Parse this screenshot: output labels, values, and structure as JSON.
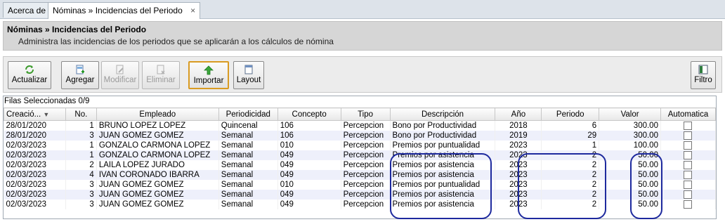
{
  "tabs": [
    {
      "label": "Acerca de"
    },
    {
      "label": "Nóminas » Incidencias del Periodo",
      "close": "×"
    }
  ],
  "header": {
    "title": "Nóminas » Incidencias del Periodo",
    "subtitle": "Administra las incidencias de los periodos que se aplicarán a los cálculos de nómina"
  },
  "toolbar": {
    "actualizar": {
      "label": "Actualizar",
      "icon": "refresh-icon"
    },
    "agregar": {
      "label": "Agregar",
      "icon": "add-doc-icon"
    },
    "modificar": {
      "label": "Modificar",
      "icon": "edit-doc-icon"
    },
    "eliminar": {
      "label": "Eliminar",
      "icon": "delete-doc-icon"
    },
    "importar": {
      "label": "Importar",
      "icon": "import-arrow-icon"
    },
    "layout": {
      "label": "Layout",
      "icon": "layout-icon"
    },
    "filtro": {
      "label": "Filtro",
      "icon": "filter-icon"
    }
  },
  "grid": {
    "selected_text": "Filas Seleccionadas  0/9",
    "columns": [
      "Creació...",
      "No.",
      "Empleado",
      "Periodicidad",
      "Concepto",
      "Tipo",
      "Descripción",
      "Año",
      "Periodo",
      "Valor",
      "Automatica"
    ],
    "rows": [
      [
        "28/01/2020",
        "1",
        "BRUNO LOPEZ LOPEZ",
        "Quincenal",
        "106",
        "Percepcion",
        "Bono por Productividad",
        "2018",
        "6",
        "300.00"
      ],
      [
        "28/01/2020",
        "3",
        "JUAN GOMEZ GOMEZ",
        "Semanal",
        "106",
        "Percepcion",
        "Bono por Productividad",
        "2019",
        "29",
        "300.00"
      ],
      [
        "02/03/2023",
        "1",
        "GONZALO CARMONA LOPEZ",
        "Semanal",
        "010",
        "Percepcion",
        "Premios por puntualidad",
        "2023",
        "1",
        "100.00"
      ],
      [
        "02/03/2023",
        "1",
        "GONZALO CARMONA LOPEZ",
        "Semanal",
        "049",
        "Percepcion",
        "Premios por asistencia",
        "2023",
        "2",
        "50.00"
      ],
      [
        "02/03/2023",
        "2",
        "LAILA LOPEZ JURADO",
        "Semanal",
        "049",
        "Percepcion",
        "Premios por asistencia",
        "2023",
        "2",
        "50.00"
      ],
      [
        "02/03/2023",
        "4",
        "IVAN CORONADO IBARRA",
        "Semanal",
        "049",
        "Percepcion",
        "Premios por asistencia",
        "2023",
        "2",
        "50.00"
      ],
      [
        "02/03/2023",
        "3",
        "JUAN GOMEZ GOMEZ",
        "Semanal",
        "010",
        "Percepcion",
        "Premios por puntualidad",
        "2023",
        "2",
        "50.00"
      ],
      [
        "02/03/2023",
        "3",
        "JUAN GOMEZ GOMEZ",
        "Semanal",
        "049",
        "Percepcion",
        "Premios por asistencia",
        "2023",
        "2",
        "50.00"
      ],
      [
        "02/03/2023",
        "3",
        "JUAN GOMEZ GOMEZ",
        "Semanal",
        "049",
        "Percepcion",
        "Premios por asistencia",
        "2023",
        "2",
        "50.00"
      ]
    ]
  },
  "colors": {
    "annotation": "#1e2a9e",
    "row_alt": "#eef0fb",
    "header_bg": "#d6d6d6"
  }
}
